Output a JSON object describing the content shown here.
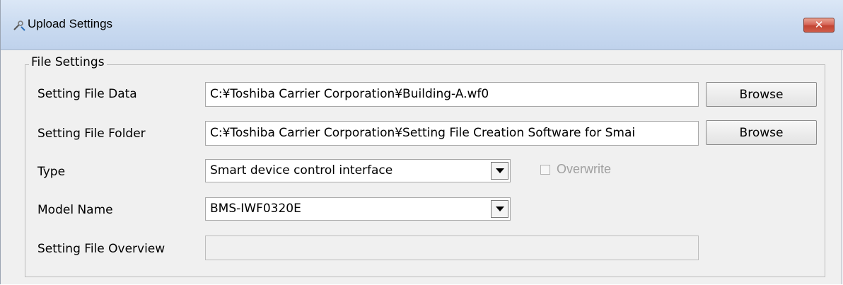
{
  "window": {
    "title": "Upload Settings",
    "close_label": "✕"
  },
  "group": {
    "title": "File Settings"
  },
  "rows": {
    "data": {
      "label": "Setting File Data",
      "value": "C:¥Toshiba Carrier Corporation¥Building-A.wf0",
      "button": "Browse"
    },
    "folder": {
      "label": "Setting File Folder",
      "value": "C:¥Toshiba Carrier Corporation¥Setting File Creation Software for Smai",
      "button": "Browse"
    },
    "type": {
      "label": "Type",
      "value": "Smart device control interface"
    },
    "overwrite": {
      "label": "Overwrite",
      "checked": false,
      "enabled": false
    },
    "model": {
      "label": "Model Name",
      "value": "BMS-IWF0320E"
    },
    "overview": {
      "label": "Setting File Overview",
      "value": ""
    }
  }
}
